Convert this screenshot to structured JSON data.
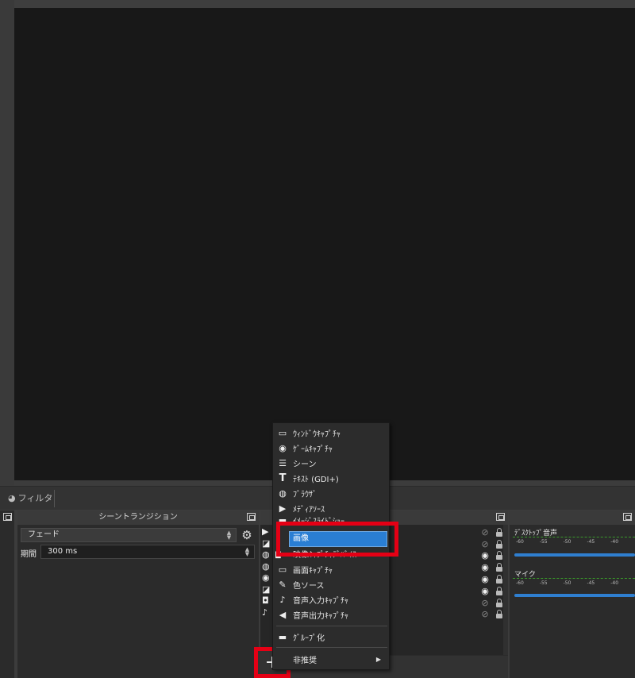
{
  "preview": {},
  "tabs": {
    "filters_label": "フィルタ"
  },
  "transition": {
    "title": "シーントランジション",
    "selected": "フェード",
    "duration_label": "期間",
    "duration_value": "300 ms"
  },
  "menu": {
    "items": [
      {
        "icon": "window-icon",
        "glyph": "▭",
        "label": "ｳｨﾝﾄﾞｳｷｬﾌﾟﾁｬ"
      },
      {
        "icon": "gamepad-icon",
        "glyph": "◉",
        "label": "ｹﾞｰﾑｷｬﾌﾟﾁｬ"
      },
      {
        "icon": "list-icon",
        "glyph": "☰",
        "label": "シーン"
      },
      {
        "icon": "text-icon",
        "glyph": "T",
        "label": "ﾃｷｽﾄ (GDI+)"
      },
      {
        "icon": "globe-icon",
        "glyph": "◍",
        "label": "ﾌﾞﾗｳｻﾞ"
      },
      {
        "icon": "play-icon",
        "glyph": "▶",
        "label": "ﾒﾃﾞｨｱｿｰｽ"
      },
      {
        "icon": "folder-icon",
        "glyph": "▬",
        "label": "ｲﾒｰｼﾞｽﾗｲﾄﾞｼｮｰ"
      },
      {
        "icon": "image-icon",
        "glyph": "◪",
        "label": "画像"
      },
      {
        "icon": "camera-icon",
        "glyph": "◘",
        "label": "映像ｷｬﾌﾟﾁｬﾃﾞﾊﾞｲｽ"
      },
      {
        "icon": "monitor-icon",
        "glyph": "▭",
        "label": "画面ｷｬﾌﾟﾁｬ"
      },
      {
        "icon": "brush-icon",
        "glyph": "✎",
        "label": "色ソース"
      },
      {
        "icon": "mic-icon",
        "glyph": "♪",
        "label": "音声入力ｷｬﾌﾟﾁｬ"
      },
      {
        "icon": "speaker-icon",
        "glyph": "◀",
        "label": "音声出力ｷｬﾌﾟﾁｬ"
      }
    ],
    "group_label": "ｸﾞﾙｰﾌﾟ化",
    "deprecated_label": "非推奨",
    "selected_label": "画像"
  },
  "sources": {
    "add_button": "+",
    "visibility": [
      "off",
      "off",
      "on",
      "on",
      "on",
      "on",
      "off",
      "off"
    ]
  },
  "mixer": {
    "tracks": [
      {
        "name": "ﾃﾞｽｸﾄｯﾌﾟ音声",
        "ticks": [
          "-60",
          "-55",
          "-50",
          "-45",
          "-40"
        ]
      },
      {
        "name": "マイク",
        "ticks": [
          "-60",
          "-55",
          "-50",
          "-45",
          "-40"
        ]
      }
    ],
    "colors": {
      "meter": "#2f7fd0",
      "scale": "#3a9a2a"
    }
  },
  "colors": {
    "highlight": "#e50015",
    "selection": "#2a7ed3"
  }
}
